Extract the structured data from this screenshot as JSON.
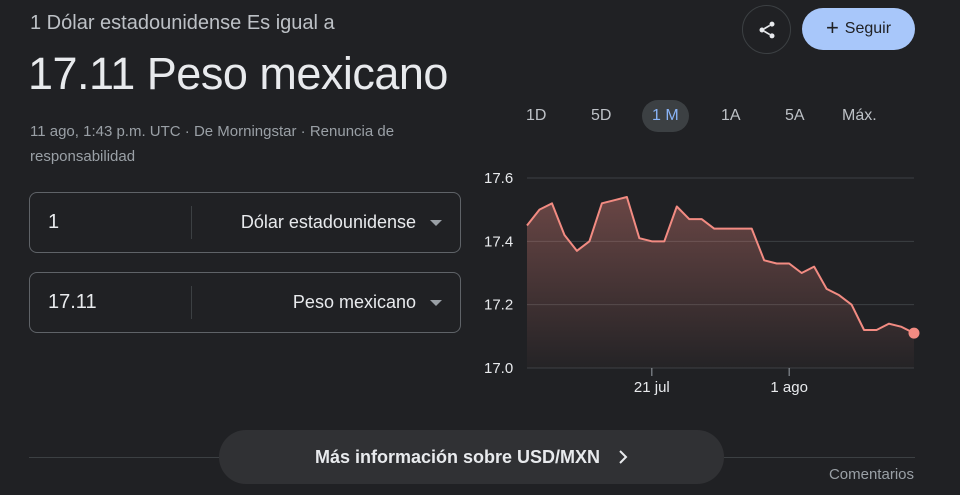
{
  "header": {
    "subtitle": "1 Dólar estadounidense Es igual a",
    "headline": "17.11 Peso mexicano",
    "meta": "11 ago, 1:43 p.m. UTC · De Morningstar · Renuncia de responsabilidad"
  },
  "actions": {
    "share_icon": "share-icon",
    "follow_label": "Seguir"
  },
  "converter": {
    "from": {
      "amount": "1",
      "currency": "Dólar estadounidense"
    },
    "to": {
      "amount": "17.11",
      "currency": "Peso mexicano"
    }
  },
  "range_tabs": [
    "1D",
    "5D",
    "1 M",
    "1A",
    "5A",
    "Máx."
  ],
  "active_range": "1 M",
  "chart_data": {
    "type": "area",
    "ylim": [
      17.0,
      17.6
    ],
    "yticks": [
      "17.6",
      "17.4",
      "17.2",
      "17.0"
    ],
    "xtick_labels": [
      {
        "label": "21 jul",
        "index": 10
      },
      {
        "label": "1 ago",
        "index": 21
      }
    ],
    "values": [
      17.45,
      17.5,
      17.52,
      17.42,
      17.37,
      17.4,
      17.52,
      17.53,
      17.54,
      17.41,
      17.4,
      17.4,
      17.51,
      17.47,
      17.47,
      17.44,
      17.44,
      17.44,
      17.44,
      17.34,
      17.33,
      17.33,
      17.3,
      17.32,
      17.25,
      17.23,
      17.2,
      17.12,
      17.12,
      17.14,
      17.13,
      17.11
    ],
    "line_color": "#f28b82",
    "grid_color": "#3c4043"
  },
  "footer": {
    "more_info": "Más información sobre USD/MXN",
    "feedback": "Comentarios"
  }
}
